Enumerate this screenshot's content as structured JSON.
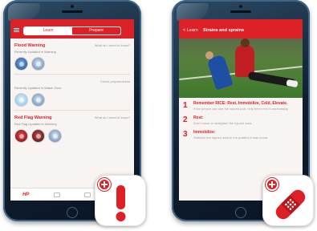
{
  "left_app": {
    "segments": [
      "Learn",
      "Prepare"
    ],
    "sections": [
      {
        "title": "Flood Warning",
        "link": "What do I need to know?",
        "subtitle": "Recently Updated in Warning",
        "icons": [
          "flood-icon",
          "person-icon"
        ]
      },
      {
        "subtitle": "Recently Updated in Watch Zone",
        "link": "Check preparedness",
        "icons": [
          "snow-icon",
          "person-icon"
        ]
      },
      {
        "title": "Red Flag Warning",
        "link": "What do I need to know?",
        "subtitle": "Red Flag Updated in Warning",
        "icons": [
          "fire-icon",
          "fire-icon",
          "person-icon"
        ]
      }
    ],
    "tabbar_brand": "HP"
  },
  "right_app": {
    "back_label": "< Learn",
    "title": "Strains and sprains",
    "steps": [
      {
        "number": "1",
        "title": "Remember RICE: Rest, Immobilize, Cold, Elevate.",
        "text": "If the person can use the injured part, help them rest it comfortably."
      },
      {
        "number": "2",
        "title": "Rest:",
        "text": "Don't move or straighten the injured area."
      },
      {
        "number": "3",
        "title": "Immobilize:",
        "text": "Stabilize the injured area in the position it was found."
      }
    ]
  },
  "badges": {
    "left_icon": "exclamation-icon",
    "right_icon": "bandage-icon",
    "accent": "#dd1f26"
  }
}
